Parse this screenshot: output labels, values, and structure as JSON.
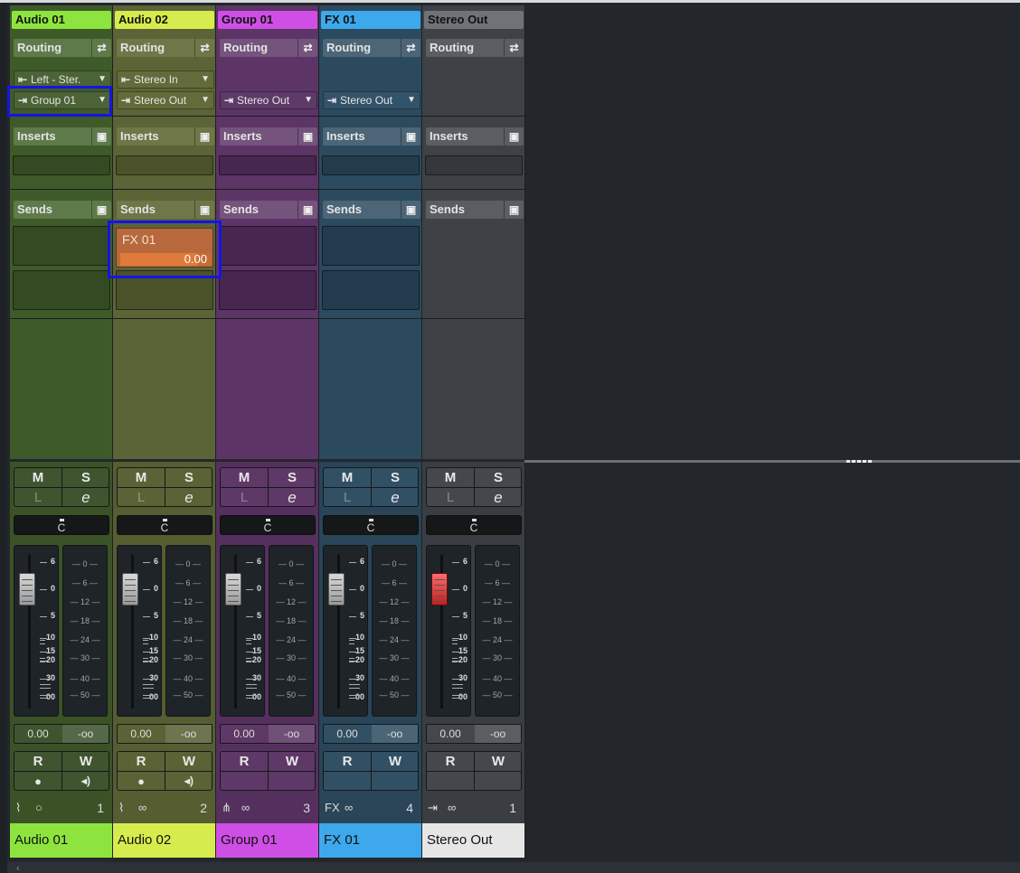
{
  "channels": [
    {
      "name": "Audio 01",
      "footer": "Audio 01",
      "routing_label": "Routing",
      "input": "Left - Ster.",
      "output": "Group 01",
      "inserts_label": "Inserts",
      "sends_label": "Sends",
      "send": null,
      "pan": "C",
      "mute": "M",
      "solo": "S",
      "listen": "L",
      "edit": "e",
      "read": "R",
      "write": "W",
      "volume": "0.00",
      "peak": "-oo",
      "number": "1",
      "type_icon": "waveform-icon",
      "link_icon": "circle-icon",
      "fader_red": false,
      "has_rw_icons": true,
      "colors": {
        "accent": "#8ee43e",
        "upper": "#3f5a29",
        "lower": "#3b5226",
        "hdr": "#5f7a4a",
        "dd": "#4b6336",
        "slot": "#344a22",
        "btn": "#3e5530"
      }
    },
    {
      "name": "Audio 02",
      "footer": "Audio 02",
      "routing_label": "Routing",
      "input": "Stereo In",
      "output": "Stereo Out",
      "inserts_label": "Inserts",
      "sends_label": "Sends",
      "send": {
        "target": "FX 01",
        "value": "0.00",
        "level": 0.85
      },
      "pan": "C",
      "mute": "M",
      "solo": "S",
      "listen": "L",
      "edit": "e",
      "read": "R",
      "write": "W",
      "volume": "0.00",
      "peak": "-oo",
      "number": "2",
      "type_icon": "waveform-icon",
      "link_icon": "link-icon",
      "fader_red": false,
      "has_rw_icons": true,
      "colors": {
        "accent": "#d6ec4e",
        "upper": "#5b6436",
        "lower": "#565d31",
        "hdr": "#6f7648",
        "dd": "#636b3a",
        "slot": "#4b5229",
        "btn": "#5a6236"
      }
    },
    {
      "name": "Group 01",
      "footer": "Group 01",
      "routing_label": "Routing",
      "input": "",
      "output": "Stereo Out",
      "inserts_label": "Inserts",
      "sends_label": "Sends",
      "send": null,
      "pan": "C",
      "mute": "M",
      "solo": "S",
      "listen": "L",
      "edit": "e",
      "read": "R",
      "write": "W",
      "volume": "0.00",
      "peak": "-oo",
      "number": "3",
      "type_icon": "group-icon",
      "link_icon": "link-icon",
      "fader_red": false,
      "has_rw_icons": false,
      "colors": {
        "accent": "#cf4fe6",
        "upper": "#5c3566",
        "lower": "#55305e",
        "hdr": "#74537c",
        "dd": "#5e3a68",
        "slot": "#472750",
        "btn": "#5e3866"
      }
    },
    {
      "name": "FX 01",
      "footer": "FX 01",
      "routing_label": "Routing",
      "input": "",
      "output": "Stereo Out",
      "inserts_label": "Inserts",
      "sends_label": "Sends",
      "send": null,
      "pan": "C",
      "mute": "M",
      "solo": "S",
      "listen": "L",
      "edit": "e",
      "read": "R",
      "write": "W",
      "volume": "0.00",
      "peak": "-oo",
      "number": "4",
      "type_icon": "fx-icon",
      "link_icon": "link-icon",
      "fader_red": false,
      "has_rw_icons": false,
      "colors": {
        "accent": "#3ea8ec",
        "upper": "#2c4a5e",
        "lower": "#294557",
        "hdr": "#4c6678",
        "dd": "#33536a",
        "slot": "#233c4d",
        "btn": "#315064"
      }
    },
    {
      "name": "Stereo Out",
      "footer": "Stereo Out",
      "routing_label": "Routing",
      "input": "",
      "output": "",
      "inserts_label": "Inserts",
      "sends_label": "Sends",
      "send": null,
      "pan": "C",
      "mute": "M",
      "solo": "S",
      "listen": "L",
      "edit": "e",
      "read": "R",
      "write": "W",
      "volume": "0.00",
      "peak": "-oo",
      "number": "1",
      "type_icon": "output-icon",
      "link_icon": "link-icon",
      "fader_red": true,
      "has_rw_icons": false,
      "colors": {
        "accent": "#6f7276",
        "upper": "#3e4246",
        "lower": "#3a3e42",
        "hdr": "#5a5e62",
        "dd": "#44484c",
        "slot": "#34383c",
        "btn": "#44484c"
      }
    }
  ],
  "fader_scale": [
    "6",
    "0",
    "5",
    "10",
    "15",
    "20",
    "30",
    "00"
  ],
  "meter_scale": [
    "0",
    "6",
    "12",
    "18",
    "24",
    "30",
    "40",
    "50"
  ],
  "highlight_color": "#1414e6"
}
